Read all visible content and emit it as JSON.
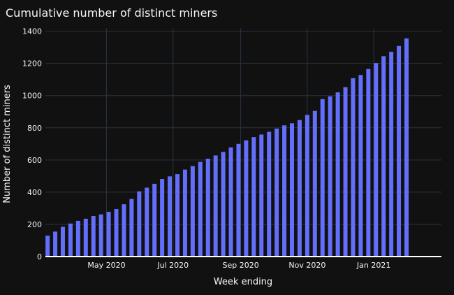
{
  "chart_data": {
    "type": "bar",
    "title": "Cumulative number of distinct miners",
    "xlabel": "Week ending",
    "ylabel": "Number of distinct miners",
    "ylim": [
      0,
      1420
    ],
    "yticks": [
      0,
      200,
      400,
      600,
      800,
      1000,
      1200,
      1400
    ],
    "xlim": [
      "2020-03-06",
      "2021-03-04"
    ],
    "xticks": [
      {
        "date": "2020-05-01",
        "label": "May 2020"
      },
      {
        "date": "2020-07-01",
        "label": "Jul 2020"
      },
      {
        "date": "2020-09-01",
        "label": "Sep 2020"
      },
      {
        "date": "2020-11-01",
        "label": "Nov 2020"
      },
      {
        "date": "2021-01-01",
        "label": "Jan 2021"
      }
    ],
    "grid": true,
    "bar_color": "#636EFA",
    "background_color": "#111111",
    "x": [
      "2020-03-08",
      "2020-03-15",
      "2020-03-22",
      "2020-03-29",
      "2020-04-05",
      "2020-04-12",
      "2020-04-19",
      "2020-04-26",
      "2020-05-03",
      "2020-05-10",
      "2020-05-17",
      "2020-05-24",
      "2020-05-31",
      "2020-06-07",
      "2020-06-14",
      "2020-06-21",
      "2020-06-28",
      "2020-07-05",
      "2020-07-12",
      "2020-07-19",
      "2020-07-26",
      "2020-08-02",
      "2020-08-09",
      "2020-08-16",
      "2020-08-23",
      "2020-08-30",
      "2020-09-06",
      "2020-09-13",
      "2020-09-20",
      "2020-09-27",
      "2020-10-04",
      "2020-10-11",
      "2020-10-18",
      "2020-10-25",
      "2020-11-01",
      "2020-11-08",
      "2020-11-15",
      "2020-11-22",
      "2020-11-29",
      "2020-12-06",
      "2020-12-13",
      "2020-12-20",
      "2020-12-27",
      "2021-01-03",
      "2021-01-10",
      "2021-01-17",
      "2021-01-24",
      "2021-01-31",
      "2021-02-07",
      "2021-02-14",
      "2021-02-21",
      "2021-02-28"
    ],
    "values": [
      130,
      155,
      185,
      205,
      222,
      235,
      252,
      262,
      278,
      295,
      325,
      358,
      405,
      428,
      452,
      482,
      498,
      512,
      540,
      562,
      588,
      608,
      628,
      650,
      678,
      700,
      722,
      742,
      758,
      775,
      795,
      815,
      828,
      848,
      880,
      905,
      978,
      995,
      1020,
      1052,
      1108,
      1128,
      1165,
      1202,
      1245,
      1272,
      1308,
      1355,
      0,
      0,
      0,
      0
    ]
  }
}
